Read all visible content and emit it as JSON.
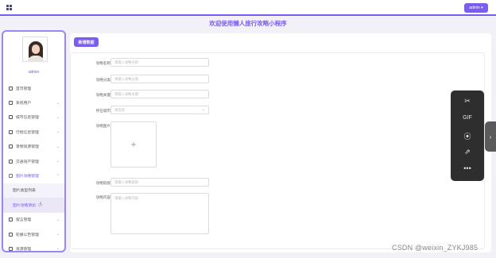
{
  "topbar": {
    "admin_button": "admin ▾"
  },
  "banner": {
    "title": "欢迎使用懒人旅行攻略小程序"
  },
  "sidebar": {
    "user_name": "admin",
    "items": [
      {
        "label": "首页管理",
        "chevron": ""
      },
      {
        "label": "系统用户",
        "chevron": "⌄"
      },
      {
        "label": "城市信息管理",
        "chevron": "⌄"
      },
      {
        "label": "行程信息管理",
        "chevron": "⌄"
      },
      {
        "label": "景物资源管理",
        "chevron": "⌄"
      },
      {
        "label": "交通资产管理",
        "chevron": "⌄"
      },
      {
        "label": "图片攻略管理",
        "chevron": "⌃"
      },
      {
        "label": "图片类型列表",
        "chevron": ""
      },
      {
        "label": "图片攻略添加",
        "chevron": ""
      },
      {
        "label": "留言管理",
        "chevron": "⌄"
      },
      {
        "label": "轮播公告管理",
        "chevron": "⌄"
      },
      {
        "label": "资源管理",
        "chevron": "⌄"
      }
    ]
  },
  "main": {
    "tag": "新增数据",
    "fields": {
      "name": {
        "label": "攻略名称",
        "placeholder": "请输入攻略名称"
      },
      "category": {
        "label": "攻略分类",
        "placeholder": "请输入攻略分类"
      },
      "keywords": {
        "label": "攻略关键",
        "placeholder": "请输入攻略关键"
      },
      "city": {
        "label": "所在城市",
        "placeholder": "请选择",
        "arrow": "⌄"
      },
      "image": {
        "label": "攻略图片",
        "plus": "+"
      },
      "link": {
        "label": "攻略链接",
        "placeholder": "请输入攻略链接"
      },
      "content": {
        "label": "攻略内容",
        "placeholder": "请输入攻略内容"
      }
    }
  },
  "toolbar": {
    "scissors": "✂",
    "gif": "GIF",
    "record": "⦿",
    "share": "⇗",
    "more": "•••"
  },
  "side_tab": {
    "arrow": "›"
  },
  "watermark": "CSDN @weixin_ZYKJ985"
}
